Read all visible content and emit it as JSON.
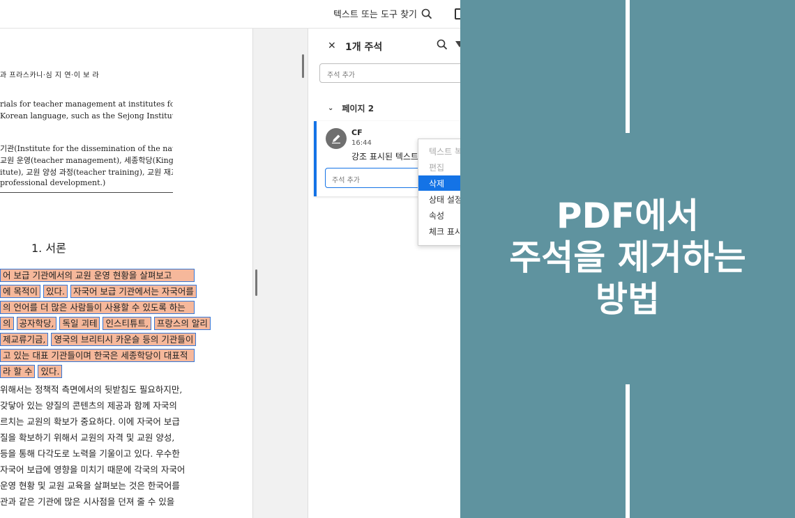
{
  "topbar": {
    "search_tool_label": "텍스트 또는 도구 찾기"
  },
  "document": {
    "authors": "과 프라스카니·심 지 연·이 보 라",
    "abstract_lines": [
      "rials for teacher management at institutes for the",
      "Korean language, such as the Sejong Institute."
    ],
    "keyword_lines": [
      " 기관(Institute for the dissemination of the national",
      "교원 운영(teacher management), 세종학당(King",
      "itute), 교원 양성 과정(teacher training), 교원 재교",
      "professional development.)"
    ],
    "section_title": "1.  서론",
    "highlighted_lines": [
      [
        "어 보급 기관에서의 교원 운영 현황을 살펴보고"
      ],
      [
        "에 목적이",
        "있다.",
        "자국어 보급 기관에서는 자국어를"
      ],
      [
        "의 언어를 더 많은 사람들이 사용할 수 있도록 하는"
      ],
      [
        "의",
        "공자학당,",
        "독일 괴테",
        "인스티튜트,",
        "프랑스의 알리"
      ],
      [
        "제교류기금,",
        "영국의 브리티시 카운슬 등의 기관들이"
      ],
      [
        "고 있는 대표 기관들이며 한국은 세종학당이 대표적"
      ],
      [
        "라 할 수",
        "있다."
      ]
    ],
    "body_lines": [
      "위해서는 정책적 측면에서의 뒷받침도 필요하지만,",
      "갖닿아 있는 양질의 콘텐츠의 제공과 함께 자국의",
      "르치는 교원의 확보가 중요하다. 이에 자국어 보급",
      "질을 확보하기 위해서 교원의 자격 및 교원 양성,",
      "등을 통해 다각도로 노력을 기울이고 있다. 우수한",
      "자국어 보급에 영향을 미치기 때문에 각국의 자국어",
      "운영 현황 및 교원 교육을 살펴보는 것은 한국어를",
      "관과 같은 기관에 많은 시사점을 던져 줄 수 있을"
    ]
  },
  "panel": {
    "title": "1개 주석",
    "add_comment_placeholder": "주석 추가",
    "page_group_label": "페이지 2",
    "comment": {
      "author": "CF",
      "time": "16:44",
      "text": "강조 표시된 텍스트",
      "reply_placeholder": "주석 추가"
    },
    "context_menu": [
      {
        "label": "텍스트 복사",
        "state": "disabled"
      },
      {
        "label": "편집",
        "state": "disabled"
      },
      {
        "label": "삭제",
        "state": "active"
      },
      {
        "label": "상태 설정",
        "state": "normal"
      },
      {
        "label": "속성",
        "state": "normal"
      },
      {
        "label": "체크 표시",
        "state": "normal"
      }
    ]
  },
  "overlay": {
    "title_lines": [
      "PDF에서",
      "주석을 제거하는",
      "방법"
    ],
    "background_color": "#5f939f"
  },
  "colors": {
    "accent": "#1473e6",
    "highlight": "#f6b89b",
    "highlight_border": "#3477d8"
  }
}
